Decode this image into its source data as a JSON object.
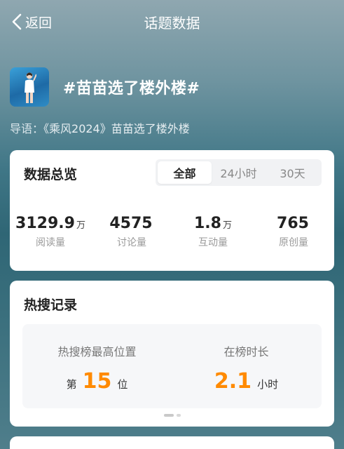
{
  "nav": {
    "back_label": "返回",
    "title": "话题数据"
  },
  "topic": {
    "title": "#苗苗选了楼外楼#",
    "intro_label": "导语：",
    "intro_text": "《乘风2024》苗苗选了楼外楼"
  },
  "overview": {
    "title": "数据总览",
    "tabs": [
      "全部",
      "24小时",
      "30天"
    ],
    "active_tab": "全部",
    "stats": [
      {
        "value": "3129.9",
        "unit": "万",
        "label": "阅读量"
      },
      {
        "value": "4575",
        "unit": "",
        "label": "讨论量"
      },
      {
        "value": "1.8",
        "unit": "万",
        "label": "互动量"
      },
      {
        "value": "765",
        "unit": "",
        "label": "原创量"
      }
    ]
  },
  "hot_search": {
    "title": "热搜记录",
    "highest_label": "热搜榜最高位置",
    "highest_prefix": "第",
    "highest_value": "15",
    "highest_suffix": "位",
    "duration_label": "在榜时长",
    "duration_value": "2.1",
    "duration_unit": "小时"
  },
  "colors": {
    "accent": "#ff8a00",
    "card_bg": "#ffffff"
  },
  "icons": {
    "back": "chevron-left-icon"
  }
}
